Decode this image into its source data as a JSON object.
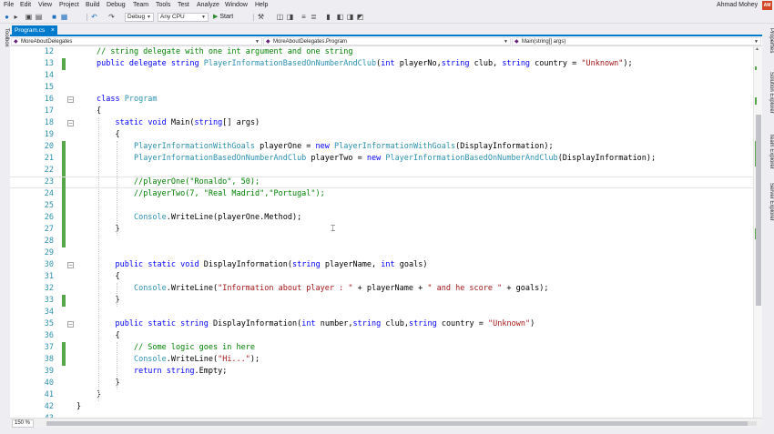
{
  "menu": {
    "items": [
      "File",
      "Edit",
      "View",
      "Project",
      "Build",
      "Debug",
      "Team",
      "Tools",
      "Test",
      "Analyze",
      "Window",
      "Help"
    ]
  },
  "user": {
    "name": "Ahmad Mohey",
    "initials": "AM"
  },
  "toolbar": {
    "configuration": "Debug",
    "platform": "Any CPU",
    "start_label": "Start"
  },
  "left_strip": {
    "toolbox_label": "Toolbox"
  },
  "right_strip": {
    "properties_label": "Properties",
    "solution_explorer_label": "Solution Explorer",
    "team_explorer_label": "Team Explorer",
    "server_explorer_label": "Server Explorer"
  },
  "document_tab": {
    "label": "Program.cs"
  },
  "navbar": {
    "project": "MoreAboutDelegates",
    "class": "MoreAboutDelegates.Program",
    "member": "Main(string[] args)"
  },
  "editor": {
    "lines": [
      {
        "n": "12",
        "changed": false,
        "fold": "",
        "indent": 0,
        "tokens": [
          {
            "t": "cm",
            "v": "// string delegate with one int argument and one string"
          }
        ]
      },
      {
        "n": "13",
        "changed": true,
        "fold": "",
        "indent": 0,
        "tokens": [
          {
            "t": "kw",
            "v": "public"
          },
          {
            "t": "pl",
            "v": " "
          },
          {
            "t": "kw",
            "v": "delegate"
          },
          {
            "t": "pl",
            "v": " "
          },
          {
            "t": "kw",
            "v": "string"
          },
          {
            "t": "pl",
            "v": " "
          },
          {
            "t": "ty",
            "v": "PlayerInformationBasedOnNumberAndClub"
          },
          {
            "t": "pl",
            "v": "("
          },
          {
            "t": "kw",
            "v": "int"
          },
          {
            "t": "pl",
            "v": " playerNo,"
          },
          {
            "t": "kw",
            "v": "string"
          },
          {
            "t": "pl",
            "v": " club, "
          },
          {
            "t": "kw",
            "v": "string"
          },
          {
            "t": "pl",
            "v": " country = "
          },
          {
            "t": "st",
            "v": "\"Unknown\""
          },
          {
            "t": "pl",
            "v": ");"
          }
        ]
      },
      {
        "n": "14",
        "changed": false,
        "fold": "",
        "indent": 0,
        "tokens": []
      },
      {
        "n": "15",
        "changed": false,
        "fold": "",
        "indent": 0,
        "tokens": []
      },
      {
        "n": "16",
        "changed": false,
        "fold": "−",
        "indent": 0,
        "tokens": [
          {
            "t": "kw",
            "v": "class"
          },
          {
            "t": "pl",
            "v": " "
          },
          {
            "t": "ty",
            "v": "Program"
          }
        ]
      },
      {
        "n": "17",
        "changed": false,
        "fold": "",
        "indent": 0,
        "tokens": [
          {
            "t": "pl",
            "v": "{"
          }
        ]
      },
      {
        "n": "18",
        "changed": false,
        "fold": "−",
        "indent": 1,
        "tokens": [
          {
            "t": "kw",
            "v": "static"
          },
          {
            "t": "pl",
            "v": " "
          },
          {
            "t": "kw",
            "v": "void"
          },
          {
            "t": "pl",
            "v": " Main("
          },
          {
            "t": "kw",
            "v": "string"
          },
          {
            "t": "pl",
            "v": "[] args)"
          }
        ]
      },
      {
        "n": "19",
        "changed": false,
        "fold": "",
        "indent": 1,
        "tokens": [
          {
            "t": "pl",
            "v": "{"
          }
        ]
      },
      {
        "n": "20",
        "changed": true,
        "fold": "",
        "indent": 2,
        "tokens": [
          {
            "t": "ty",
            "v": "PlayerInformationWithGoals"
          },
          {
            "t": "pl",
            "v": " playerOne = "
          },
          {
            "t": "kw",
            "v": "new"
          },
          {
            "t": "pl",
            "v": " "
          },
          {
            "t": "ty",
            "v": "PlayerInformationWithGoals"
          },
          {
            "t": "pl",
            "v": "(DisplayInformation);"
          }
        ]
      },
      {
        "n": "21",
        "changed": true,
        "fold": "",
        "indent": 2,
        "tokens": [
          {
            "t": "ty",
            "v": "PlayerInformationBasedOnNumberAndClub"
          },
          {
            "t": "pl",
            "v": " playerTwo = "
          },
          {
            "t": "kw",
            "v": "new"
          },
          {
            "t": "pl",
            "v": " "
          },
          {
            "t": "ty",
            "v": "PlayerInformationBasedOnNumberAndClub"
          },
          {
            "t": "pl",
            "v": "(DisplayInformation);"
          }
        ]
      },
      {
        "n": "22",
        "changed": true,
        "fold": "",
        "indent": 2,
        "tokens": []
      },
      {
        "n": "23",
        "changed": true,
        "fold": "",
        "indent": 2,
        "current": true,
        "tokens": [
          {
            "t": "cm",
            "v": "//playerOne(\"Ronaldo\", 50);"
          }
        ]
      },
      {
        "n": "24",
        "changed": true,
        "fold": "",
        "indent": 2,
        "tokens": [
          {
            "t": "cm",
            "v": "//playerTwo(7, \"Real Madrid\",\"Portugal\");"
          }
        ]
      },
      {
        "n": "25",
        "changed": true,
        "fold": "",
        "indent": 2,
        "tokens": []
      },
      {
        "n": "26",
        "changed": true,
        "fold": "",
        "indent": 2,
        "tokens": [
          {
            "t": "ty",
            "v": "Console"
          },
          {
            "t": "pl",
            "v": ".WriteLine(playerOne.Method);"
          }
        ]
      },
      {
        "n": "27",
        "changed": true,
        "fold": "",
        "indent": 1,
        "tokens": [
          {
            "t": "pl",
            "v": "}"
          }
        ]
      },
      {
        "n": "28",
        "changed": true,
        "fold": "",
        "indent": 0,
        "tokens": []
      },
      {
        "n": "29",
        "changed": false,
        "fold": "",
        "indent": 0,
        "tokens": []
      },
      {
        "n": "30",
        "changed": false,
        "fold": "−",
        "indent": 1,
        "tokens": [
          {
            "t": "kw",
            "v": "public"
          },
          {
            "t": "pl",
            "v": " "
          },
          {
            "t": "kw",
            "v": "static"
          },
          {
            "t": "pl",
            "v": " "
          },
          {
            "t": "kw",
            "v": "void"
          },
          {
            "t": "pl",
            "v": " DisplayInformation("
          },
          {
            "t": "kw",
            "v": "string"
          },
          {
            "t": "pl",
            "v": " playerName, "
          },
          {
            "t": "kw",
            "v": "int"
          },
          {
            "t": "pl",
            "v": " goals)"
          }
        ]
      },
      {
        "n": "31",
        "changed": false,
        "fold": "",
        "indent": 1,
        "tokens": [
          {
            "t": "pl",
            "v": "{"
          }
        ]
      },
      {
        "n": "32",
        "changed": false,
        "fold": "",
        "indent": 2,
        "tokens": [
          {
            "t": "ty",
            "v": "Console"
          },
          {
            "t": "pl",
            "v": ".WriteLine("
          },
          {
            "t": "st",
            "v": "\"Information about player : \""
          },
          {
            "t": "pl",
            "v": " + playerName + "
          },
          {
            "t": "st",
            "v": "\" and he score \""
          },
          {
            "t": "pl",
            "v": " + goals);"
          }
        ]
      },
      {
        "n": "33",
        "changed": true,
        "fold": "",
        "indent": 1,
        "tokens": [
          {
            "t": "pl",
            "v": "}"
          }
        ]
      },
      {
        "n": "34",
        "changed": false,
        "fold": "",
        "indent": 0,
        "tokens": []
      },
      {
        "n": "35",
        "changed": false,
        "fold": "−",
        "indent": 1,
        "tokens": [
          {
            "t": "kw",
            "v": "public"
          },
          {
            "t": "pl",
            "v": " "
          },
          {
            "t": "kw",
            "v": "static"
          },
          {
            "t": "pl",
            "v": " "
          },
          {
            "t": "kw",
            "v": "string"
          },
          {
            "t": "pl",
            "v": " DisplayInformation("
          },
          {
            "t": "kw",
            "v": "int"
          },
          {
            "t": "pl",
            "v": " number,"
          },
          {
            "t": "kw",
            "v": "string"
          },
          {
            "t": "pl",
            "v": " club,"
          },
          {
            "t": "kw",
            "v": "string"
          },
          {
            "t": "pl",
            "v": " country = "
          },
          {
            "t": "st",
            "v": "\"Unknown\""
          },
          {
            "t": "pl",
            "v": ")"
          }
        ]
      },
      {
        "n": "36",
        "changed": false,
        "fold": "",
        "indent": 1,
        "tokens": [
          {
            "t": "pl",
            "v": "{"
          }
        ]
      },
      {
        "n": "37",
        "changed": true,
        "fold": "",
        "indent": 2,
        "tokens": [
          {
            "t": "cm",
            "v": "// Some logic goes in here"
          }
        ]
      },
      {
        "n": "38",
        "changed": true,
        "fold": "",
        "indent": 2,
        "tokens": [
          {
            "t": "ty",
            "v": "Console"
          },
          {
            "t": "pl",
            "v": ".WriteLine("
          },
          {
            "t": "st",
            "v": "\"Hi...\""
          },
          {
            "t": "pl",
            "v": ");"
          }
        ]
      },
      {
        "n": "39",
        "changed": false,
        "fold": "",
        "indent": 2,
        "tokens": [
          {
            "t": "kw",
            "v": "return"
          },
          {
            "t": "pl",
            "v": " "
          },
          {
            "t": "kw",
            "v": "string"
          },
          {
            "t": "pl",
            "v": ".Empty;"
          }
        ]
      },
      {
        "n": "40",
        "changed": false,
        "fold": "",
        "indent": 1,
        "tokens": [
          {
            "t": "pl",
            "v": "}"
          }
        ]
      },
      {
        "n": "41",
        "changed": false,
        "fold": "",
        "indent": 0,
        "tokens": [
          {
            "t": "pl",
            "v": "}"
          }
        ]
      },
      {
        "n": "42",
        "changed": false,
        "fold": "",
        "indent": -1,
        "tokens": [
          {
            "t": "pl",
            "v": "}"
          }
        ]
      },
      {
        "n": "43",
        "changed": false,
        "fold": "",
        "indent": 0,
        "tokens": []
      }
    ]
  },
  "bottom": {
    "zoom": "150 %"
  },
  "colors": {
    "accent": "#007acc",
    "keyword": "#0000ff",
    "type": "#2b91af",
    "string": "#a31515",
    "comment": "#008000",
    "changed_marker": "#57a64a"
  }
}
